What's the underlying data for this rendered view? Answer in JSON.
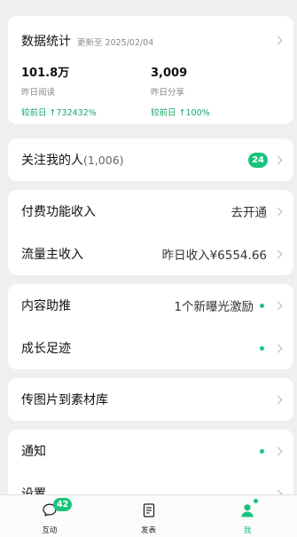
{
  "stats": {
    "title": "数据统计",
    "updated": "更新至 2025/02/04",
    "items": [
      {
        "value": "101.8万",
        "label": "昨日阅读",
        "change": "较前日 ↑732432%"
      },
      {
        "value": "3,009",
        "label": "昨日分享",
        "change": "较前日 ↑100%"
      }
    ]
  },
  "followers": {
    "label": "关注我的人",
    "count": "(1,006)",
    "badge": "24"
  },
  "income": {
    "paid_label": "付费功能收入",
    "paid_value": "去开通",
    "traffic_label": "流量主收入",
    "traffic_value": "昨日收入¥6554.66"
  },
  "growth": {
    "content_label": "内容助推",
    "content_value": "1个新曝光激励",
    "footprint_label": "成长足迹"
  },
  "upload": {
    "label": "传图片到素材库"
  },
  "settings": {
    "notice_label": "通知",
    "settings_label": "设置"
  },
  "tabbar": {
    "interact_label": "互动",
    "interact_badge": "42",
    "publish_label": "发表",
    "me_label": "我"
  },
  "colors": {
    "accent": "#19c37d",
    "background": "#efefef"
  }
}
